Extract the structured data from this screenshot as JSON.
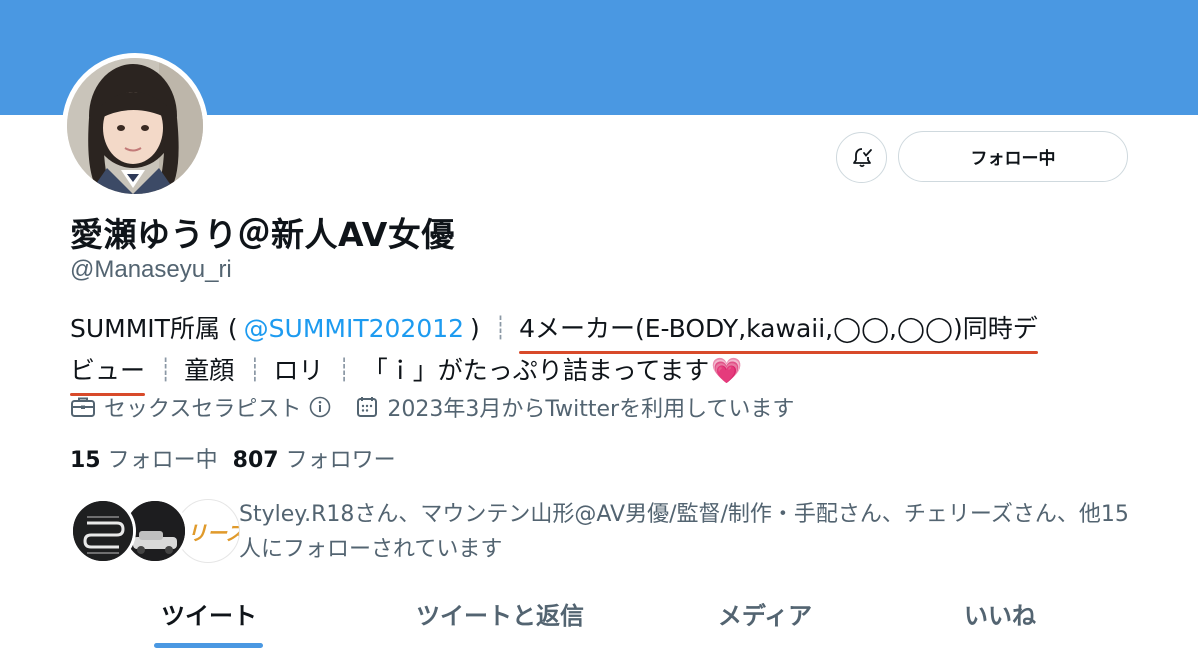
{
  "profile": {
    "display_name": "愛瀬ゆうり＠新人AV女優",
    "handle": "@Manaseyu_ri",
    "follow_button_label": "フォロー中"
  },
  "bio": {
    "part1": "SUMMIT所属 (",
    "mention": "@SUMMIT202012",
    "part2": ")",
    "highlight_line1": "4メーカー(E-BODY,kawaii,◯◯,◯◯)同時デ",
    "highlight_line2": "ビュー",
    "tag_1": "童顔",
    "tag_2": "ロリ",
    "tag_3": "「ｉ」がたっぷり詰まってます",
    "separator": "┊",
    "emoji": "💗"
  },
  "meta": {
    "category": "セックスセラピスト",
    "joined": "2023年3月からTwitterを利用しています"
  },
  "stats": {
    "following_count": "15",
    "following_label": "フォロー中",
    "followers_count": "807",
    "followers_label": "フォロワー"
  },
  "followed_by": {
    "text": "Styley.R18さん、マウンテン山形@AV男優/監督/制作・手配さん、チェリーズさん、他15人にフォローされています",
    "avatar_3_text": "リーズ"
  },
  "tabs": [
    {
      "label": "ツイート",
      "active": true
    },
    {
      "label": "ツイートと返信",
      "active": false
    },
    {
      "label": "メディア",
      "active": false
    },
    {
      "label": "いいね",
      "active": false
    }
  ],
  "colors": {
    "banner": "#4a98e2",
    "link": "#1d9bf0",
    "underline": "#d84a2a",
    "muted_text": "#536471"
  }
}
